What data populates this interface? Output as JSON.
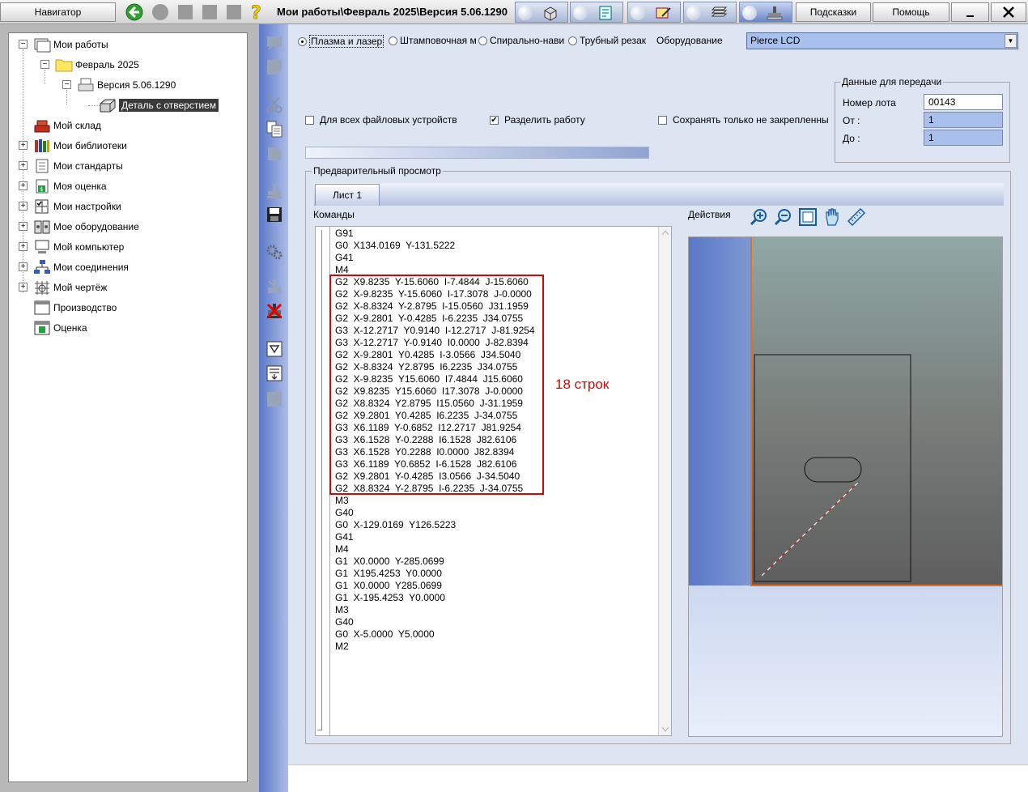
{
  "topbar": {
    "navigator_label": "Навигатор",
    "breadcrumb": "Мои работы\\Февраль 2025\\Версия 5.06.1290",
    "hints_label": "Подсказки",
    "help_label": "Помощь"
  },
  "nav": {
    "items": [
      {
        "label": "Мои работы"
      },
      {
        "label": "Февраль 2025"
      },
      {
        "label": "Версия 5.06.1290"
      },
      {
        "label": "Деталь с отверстием"
      },
      {
        "label": "Мой склад"
      },
      {
        "label": "Мои библиотеки"
      },
      {
        "label": "Мои стандарты"
      },
      {
        "label": "Моя оценка"
      },
      {
        "label": "Мои настройки"
      },
      {
        "label": "Мое оборудование"
      },
      {
        "label": "Мой компьютер"
      },
      {
        "label": "Мои соединения"
      },
      {
        "label": "Мой чертёж"
      },
      {
        "label": "Производство"
      },
      {
        "label": "Оценка"
      }
    ]
  },
  "machine_types": {
    "plasma": "Плазма и лазер",
    "stamping": "Штамповочная м",
    "spiral": "Спирально-нави",
    "tube": "Трубный резак",
    "equipment_label": "Оборудование",
    "equipment_value": "Pierce LCD"
  },
  "options": {
    "all_devices": "Для всех файловых устройств",
    "split_job": "Разделить работу",
    "save_fixed": "Сохранять только не закрепленны"
  },
  "transfer": {
    "title": "Данные для передачи",
    "lot_label": "Номер лота",
    "lot_value": "00143",
    "from_label": "От :",
    "from_value": "1",
    "to_label": "До :",
    "to_value": "1"
  },
  "preview": {
    "title": "Предварительный просмотр",
    "tab1": "Лист 1",
    "commands_label": "Команды",
    "actions_label": "Действия"
  },
  "commands": [
    "G91",
    "G0  X134.0169  Y-131.5222",
    "G41",
    "M4",
    "G2  X9.8235  Y-15.6060  I-7.4844  J-15.6060",
    "G2  X-9.8235  Y-15.6060  I-17.3078  J-0.0000",
    "G2  X-8.8324  Y-2.8795  I-15.0560  J31.1959",
    "G2  X-9.2801  Y-0.4285  I-6.2235  J34.0755",
    "G3  X-12.2717  Y0.9140  I-12.2717  J-81.9254",
    "G3  X-12.2717  Y-0.9140  I0.0000  J-82.8394",
    "G2  X-9.2801  Y0.4285  I-3.0566  J34.5040",
    "G2  X-8.8324  Y2.8795  I6.2235  J34.0755",
    "G2  X-9.8235  Y15.6060  I7.4844  J15.6060",
    "G2  X9.8235  Y15.6060  I17.3078  J-0.0000",
    "G2  X8.8324  Y2.8795  I15.0560  J-31.1959",
    "G2  X9.2801  Y0.4285  I6.2235  J-34.0755",
    "G3  X6.1189  Y-0.6852  I12.2717  J81.9254",
    "G3  X6.1528  Y-0.2288  I6.1528  J82.6106",
    "G3  X6.1528  Y0.2288  I0.0000  J82.8394",
    "G3  X6.1189  Y0.6852  I-6.1528  J82.6106",
    "G2  X9.2801  Y-0.4285  I3.0566  J-34.5040",
    "G2  X8.8324  Y-2.8795  I-6.2235  J-34.0755",
    "M3",
    "G40",
    "G0  X-129.0169  Y126.5223",
    "G41",
    "M4",
    "G1  X0.0000  Y-285.0699",
    "G1  X195.4253  Y0.0000",
    "G1  X0.0000  Y285.0699",
    "G1  X-195.4253  Y0.0000",
    "M3",
    "G40",
    "G0  X-5.0000  Y5.0000",
    "M2"
  ],
  "annotation": "18 строк",
  "colors": {
    "annotation_red": "#e00000",
    "accent_blue": "#5a78c8",
    "field_blue": "#a9c0ec"
  }
}
